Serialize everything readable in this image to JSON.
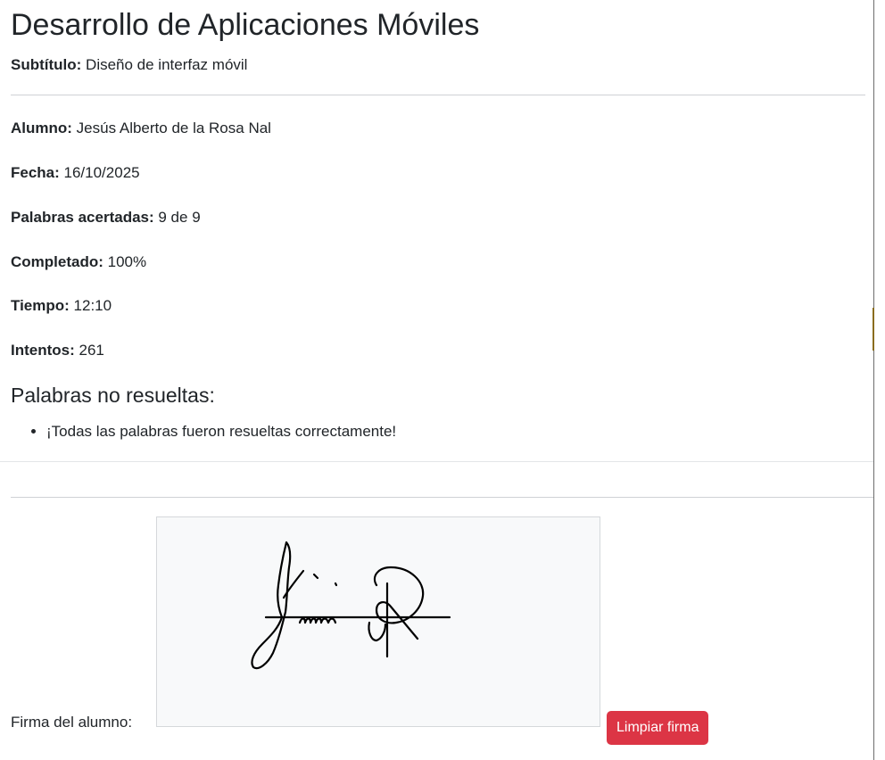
{
  "report": {
    "title": "Desarrollo de Aplicaciones Móviles",
    "subtitle_label": "Subtítulo:",
    "subtitle_value": " Diseño de interfaz móvil",
    "fields": {
      "student_label": "Alumno:",
      "student_value": " Jesús Alberto de la Rosa Nal",
      "date_label": "Fecha:",
      "date_value": " 16/10/2025",
      "words_label": "Palabras acertadas:",
      "words_value": " 9 de 9",
      "completed_label": "Completado:",
      "completed_value": " 100%",
      "time_label": "Tiempo:",
      "time_value": " 12:10",
      "attempts_label": "Intentos:",
      "attempts_value": " 261"
    },
    "unsolved_heading": "Palabras no resueltas:",
    "unsolved_items": [
      "¡Todas las palabras fueron resueltas correctamente!"
    ]
  },
  "signature": {
    "label": "Firma del alumno:",
    "clear_button": "Limpiar firma",
    "clear_button_color": "#dc3545",
    "canvas_background": "#f8f9fa"
  }
}
